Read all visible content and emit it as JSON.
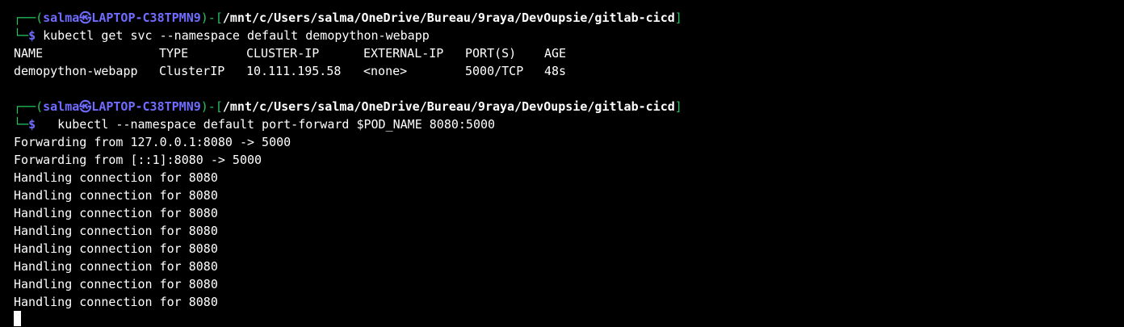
{
  "colors": {
    "background": "#000000",
    "prompt_green": "#22c55e",
    "prompt_blue": "#6f6cff",
    "text": "#ffffff"
  },
  "prompt": {
    "box_top": "┌──(",
    "user": "salma",
    "at": "㉿",
    "host": "LAPTOP-C38TPMN9",
    "close_paren": ")-[",
    "path": "/mnt/c/Users/salma/OneDrive/Bureau/9raya/DevOupsie/gitlab-cicd",
    "close_bracket": "]",
    "box_bottom": "└─",
    "dollar": "$"
  },
  "commands": [
    {
      "text": " kubectl get svc --namespace default demopython-webapp"
    },
    {
      "text": "   kubectl --namespace default port-forward $POD_NAME 8080:5000"
    }
  ],
  "svc_table": {
    "headers": [
      "NAME",
      "TYPE",
      "CLUSTER-IP",
      "EXTERNAL-IP",
      "PORT(S)",
      "AGE"
    ],
    "rows": [
      [
        "demopython-webapp",
        "ClusterIP",
        "10.111.195.58",
        "<none>",
        "5000/TCP",
        "48s"
      ]
    ]
  },
  "forward_output": [
    "Forwarding from 127.0.0.1:8080 -> 5000",
    "Forwarding from [::1]:8080 -> 5000",
    "Handling connection for 8080",
    "Handling connection for 8080",
    "Handling connection for 8080",
    "Handling connection for 8080",
    "Handling connection for 8080",
    "Handling connection for 8080",
    "Handling connection for 8080",
    "Handling connection for 8080"
  ]
}
